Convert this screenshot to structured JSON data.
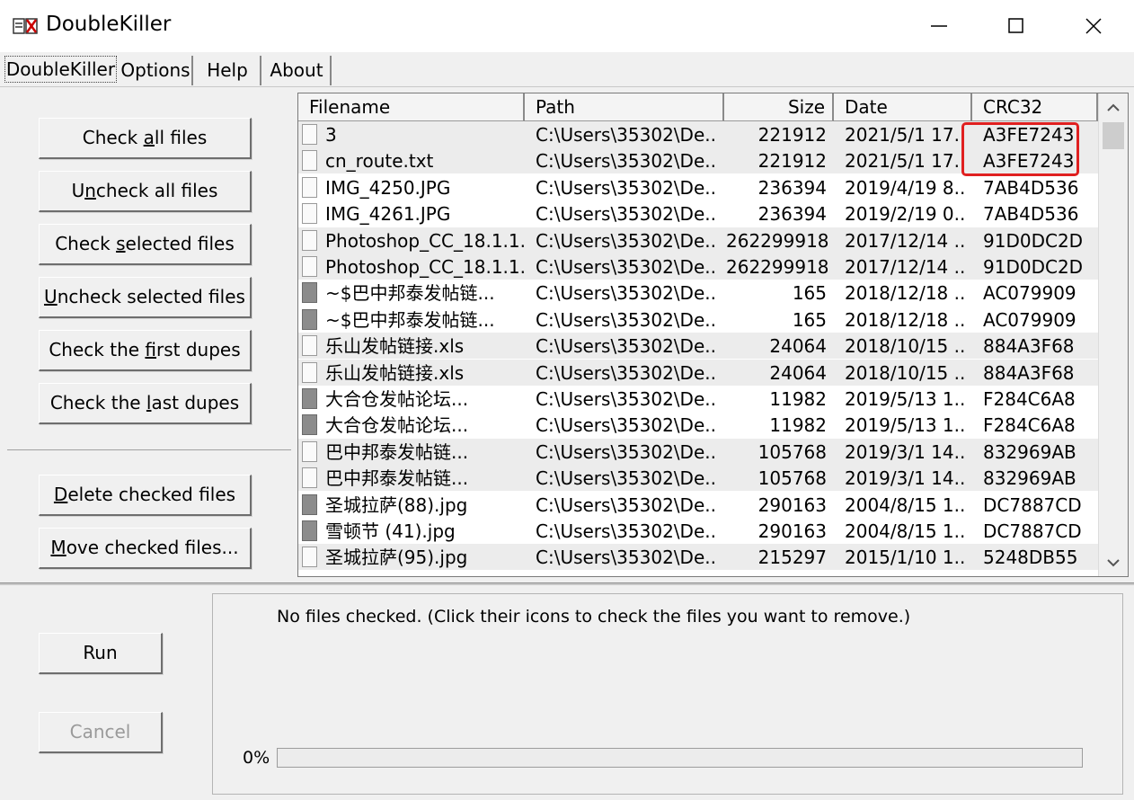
{
  "window": {
    "title": "DoubleKiller"
  },
  "tabs": [
    "DoubleKiller",
    "Options",
    "Help",
    "About"
  ],
  "left_buttons": [
    {
      "pre": "Check ",
      "u": "a",
      "post": "ll files"
    },
    {
      "pre": "U",
      "u": "n",
      "post": "check all files"
    },
    {
      "pre": "Check ",
      "u": "s",
      "post": "elected files"
    },
    {
      "pre": "",
      "u": "U",
      "post": "ncheck selected files"
    },
    {
      "pre": "Check the ",
      "u": "f",
      "post": "irst dupes"
    },
    {
      "pre": "Check the ",
      "u": "l",
      "post": "ast dupes"
    },
    {
      "pre": "",
      "u": "D",
      "post": "elete checked files"
    },
    {
      "pre": "",
      "u": "M",
      "post": "ove checked files..."
    }
  ],
  "columns": [
    "Filename",
    "Path",
    "Size",
    "Date",
    "CRC32"
  ],
  "rows": [
    {
      "icon": "light",
      "name": "3",
      "path": "C:\\Users\\35302\\De...",
      "size": "221912",
      "date": "2021/5/1 17...",
      "crc": "A3FE7243",
      "shade": true
    },
    {
      "icon": "light",
      "name": "cn_route.txt",
      "path": "C:\\Users\\35302\\De...",
      "size": "221912",
      "date": "2021/5/1 17...",
      "crc": "A3FE7243",
      "shade": true
    },
    {
      "icon": "light",
      "name": "IMG_4250.JPG",
      "path": "C:\\Users\\35302\\De...",
      "size": "236394",
      "date": "2019/4/19 8...",
      "crc": "7AB4D536",
      "shade": false
    },
    {
      "icon": "light",
      "name": "IMG_4261.JPG",
      "path": "C:\\Users\\35302\\De...",
      "size": "236394",
      "date": "2019/2/19 0...",
      "crc": "7AB4D536",
      "shade": false
    },
    {
      "icon": "light",
      "name": "Photoshop_CC_18.1.1...",
      "path": "C:\\Users\\35302\\De...",
      "size": "262299918",
      "date": "2017/12/14 ...",
      "crc": "91D0DC2D",
      "shade": true
    },
    {
      "icon": "light",
      "name": "Photoshop_CC_18.1.1...",
      "path": "C:\\Users\\35302\\De...",
      "size": "262299918",
      "date": "2017/12/14 ...",
      "crc": "91D0DC2D",
      "shade": true
    },
    {
      "icon": "dark",
      "name": "~$巴中邦泰发帖链...",
      "path": "C:\\Users\\35302\\De...",
      "size": "165",
      "date": "2018/12/18 ...",
      "crc": "AC079909",
      "shade": false
    },
    {
      "icon": "dark",
      "name": "~$巴中邦泰发帖链...",
      "path": "C:\\Users\\35302\\De...",
      "size": "165",
      "date": "2018/12/18 ...",
      "crc": "AC079909",
      "shade": false
    },
    {
      "icon": "light",
      "name": "乐山发帖链接.xls",
      "path": "C:\\Users\\35302\\De...",
      "size": "24064",
      "date": "2018/10/15 ...",
      "crc": "884A3F68",
      "shade": true
    },
    {
      "icon": "light",
      "name": "乐山发帖链接.xls",
      "path": "C:\\Users\\35302\\De...",
      "size": "24064",
      "date": "2018/10/15 ...",
      "crc": "884A3F68",
      "shade": true
    },
    {
      "icon": "dark",
      "name": "大合仓发帖论坛...",
      "path": "C:\\Users\\35302\\De...",
      "size": "11982",
      "date": "2019/5/13 1...",
      "crc": "F284C6A8",
      "shade": false
    },
    {
      "icon": "dark",
      "name": "大合仓发帖论坛...",
      "path": "C:\\Users\\35302\\De...",
      "size": "11982",
      "date": "2019/5/13 1...",
      "crc": "F284C6A8",
      "shade": false
    },
    {
      "icon": "light",
      "name": "巴中邦泰发帖链...",
      "path": "C:\\Users\\35302\\De...",
      "size": "105768",
      "date": "2019/3/1 14...",
      "crc": "832969AB",
      "shade": true
    },
    {
      "icon": "light",
      "name": "巴中邦泰发帖链...",
      "path": "C:\\Users\\35302\\De...",
      "size": "105768",
      "date": "2019/3/1 14...",
      "crc": "832969AB",
      "shade": true
    },
    {
      "icon": "dark",
      "name": "圣城拉萨(88).jpg",
      "path": "C:\\Users\\35302\\De...",
      "size": "290163",
      "date": "2004/8/15 1...",
      "crc": "DC7887CD",
      "shade": false
    },
    {
      "icon": "dark",
      "name": "雪顿节 (41).jpg",
      "path": "C:\\Users\\35302\\De...",
      "size": "290163",
      "date": "2004/8/15 1...",
      "crc": "DC7887CD",
      "shade": false
    },
    {
      "icon": "light",
      "name": "圣城拉萨(95).jpg",
      "path": "C:\\Users\\35302\\De...",
      "size": "215297",
      "date": "2015/1/10 1...",
      "crc": "5248DB55",
      "shade": true
    }
  ],
  "status_message": "No files checked. (Click their icons to check the files you want to remove.)",
  "run_label": "Run",
  "cancel_label": "Cancel",
  "progress": {
    "label": "0%",
    "value": 0
  },
  "highlight_color": "#e02020"
}
